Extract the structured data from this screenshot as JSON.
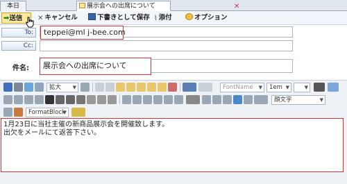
{
  "tabs": {
    "today": "本日",
    "compose": "展示会への出席について"
  },
  "toolbar": {
    "send": "送信",
    "cancel": "キャンセル",
    "save_draft": "下書きとして保存",
    "attach": "添付",
    "options": "オプション"
  },
  "compose": {
    "to_label": "To:",
    "cc_label": "Cc:",
    "to_value": "teppei@ml j-bee.com",
    "subject_label": "件名:",
    "subject_value": "展示会への出席について"
  },
  "editor_toolbar": {
    "font_size_select": "拡大",
    "font_name": "FontName",
    "size_value": "1em",
    "format_block": "FormatBlock",
    "emoji_select": "顔文字"
  },
  "body": {
    "line1": "1月23日に当社主催の新商品展示会を開催致します。",
    "line2": "出欠をメールにて返答下さい。"
  }
}
